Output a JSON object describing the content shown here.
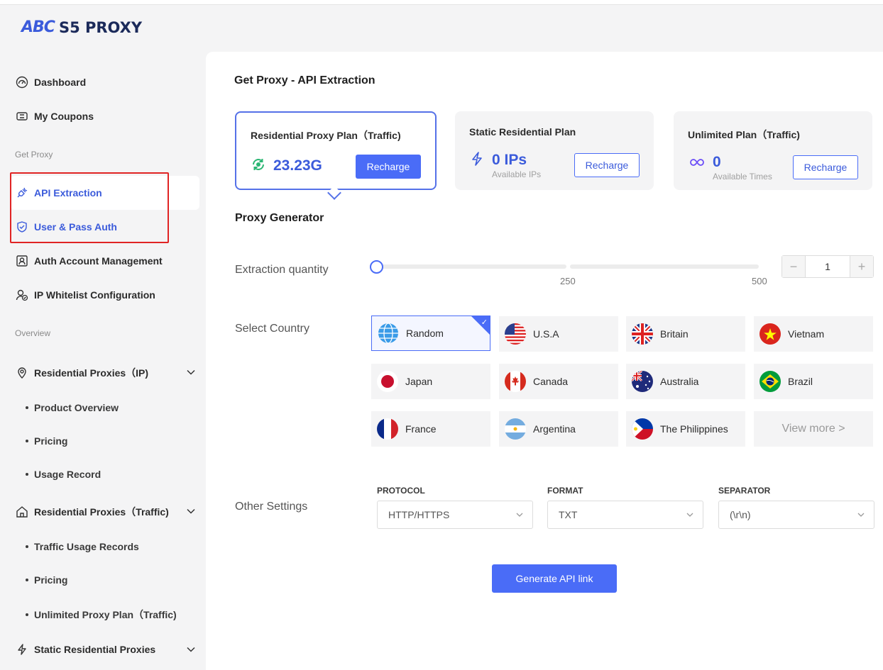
{
  "brand": {
    "mark": "ABC",
    "name": "S5 PROXY"
  },
  "sidebar": {
    "dashboard": "Dashboard",
    "coupons": "My Coupons",
    "section_get_proxy": "Get Proxy",
    "api_extraction": "API Extraction",
    "user_pass_auth": "User & Pass Auth",
    "auth_account": "Auth Account Management",
    "ip_whitelist": "IP Whitelist Configuration",
    "section_overview": "Overview",
    "res_ip": "Residential Proxies（IP)",
    "res_ip_sub": [
      "Product Overview",
      "Pricing",
      "Usage Record"
    ],
    "res_traffic": "Residential Proxies（Traffic)",
    "res_traffic_sub": [
      "Traffic Usage Records",
      "Pricing",
      "Unlimited Proxy Plan（Traffic)"
    ],
    "static_res": "Static Residential Proxies"
  },
  "main": {
    "title": "Get Proxy - API Extraction",
    "plans": [
      {
        "title": "Residential Proxy Plan（Traffic)",
        "value": "23.23G",
        "button": "Recharge"
      },
      {
        "title": "Static Residential Plan",
        "value": "0 IPs",
        "sub": "Available IPs",
        "button": "Recharge"
      },
      {
        "title": "Unlimited Plan（Traffic)",
        "value": "0",
        "sub": "Available Times",
        "button": "Recharge"
      }
    ],
    "generator_title": "Proxy Generator",
    "extraction": {
      "label": "Extraction quantity",
      "value": "1",
      "tick_mid": "250",
      "tick_max": "500",
      "minus": "−",
      "plus": "+"
    },
    "country": {
      "label": "Select Country",
      "items": [
        "Random",
        "U.S.A",
        "Britain",
        "Vietnam",
        "Japan",
        "Canada",
        "Australia",
        "Brazil",
        "France",
        "Argentina",
        "The Philippines"
      ],
      "more": "View more >"
    },
    "other": {
      "label": "Other Settings",
      "protocol_label": "PROTOCOL",
      "protocol_value": "HTTP/HTTPS",
      "format_label": "FORMAT",
      "format_value": "TXT",
      "separator_label": "SEPARATOR",
      "separator_value": "(\\r\\n)"
    },
    "generate_button": "Generate API link"
  },
  "colors": {
    "accent": "#4a6cf7",
    "highlight": "#e02424"
  }
}
